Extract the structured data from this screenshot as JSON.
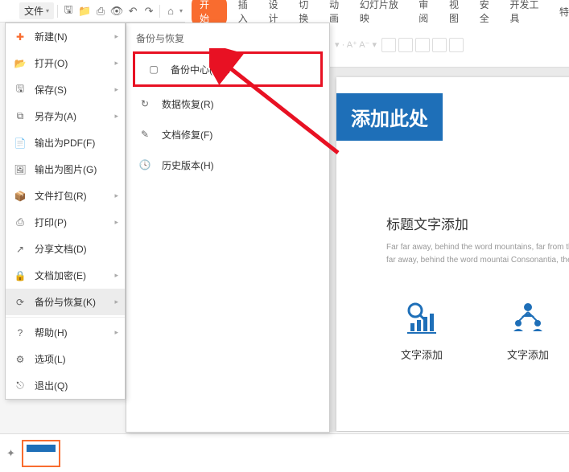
{
  "topbar": {
    "file_label": "文件"
  },
  "tabs": {
    "start": "开始",
    "insert": "插入",
    "design": "设计",
    "transition": "切换",
    "animation": "动画",
    "slideshow": "幻灯片放映",
    "review": "审阅",
    "view": "视图",
    "security": "安全",
    "devtools": "开发工具",
    "special": "特"
  },
  "file_menu": {
    "items": [
      {
        "label": "新建(N)",
        "icon": "new",
        "arrow": true,
        "orange": true
      },
      {
        "label": "打开(O)",
        "icon": "open",
        "arrow": true
      },
      {
        "label": "保存(S)",
        "icon": "save",
        "arrow": true
      },
      {
        "label": "另存为(A)",
        "icon": "saveas",
        "arrow": true
      },
      {
        "label": "输出为PDF(F)",
        "icon": "pdf",
        "arrow": false
      },
      {
        "label": "输出为图片(G)",
        "icon": "image",
        "arrow": false
      },
      {
        "label": "文件打包(R)",
        "icon": "pack",
        "arrow": true
      },
      {
        "label": "打印(P)",
        "icon": "print",
        "arrow": true
      },
      {
        "label": "分享文档(D)",
        "icon": "share",
        "arrow": false
      },
      {
        "label": "文档加密(E)",
        "icon": "encrypt",
        "arrow": true
      },
      {
        "label": "备份与恢复(K)",
        "icon": "backup",
        "arrow": true,
        "active": true
      },
      {
        "label": "帮助(H)",
        "icon": "help",
        "arrow": true
      },
      {
        "label": "选项(L)",
        "icon": "options",
        "arrow": false
      },
      {
        "label": "退出(Q)",
        "icon": "exit",
        "arrow": false
      }
    ]
  },
  "submenu": {
    "title": "备份与恢复",
    "items": [
      {
        "label": "备份中心(K)...",
        "highlighted": true
      },
      {
        "label": "数据恢复(R)"
      },
      {
        "label": "文档修复(F)"
      },
      {
        "label": "历史版本(H)"
      }
    ]
  },
  "slide": {
    "banner": "添加此处",
    "section_title": "标题文字添加",
    "body": "Far far away, behind the word mountains, far from the the blind texts. Far far away, behind the word mountai Consonantia, there live the blind texts.",
    "icon1_label": "文字添加",
    "icon2_label": "文字添加"
  }
}
